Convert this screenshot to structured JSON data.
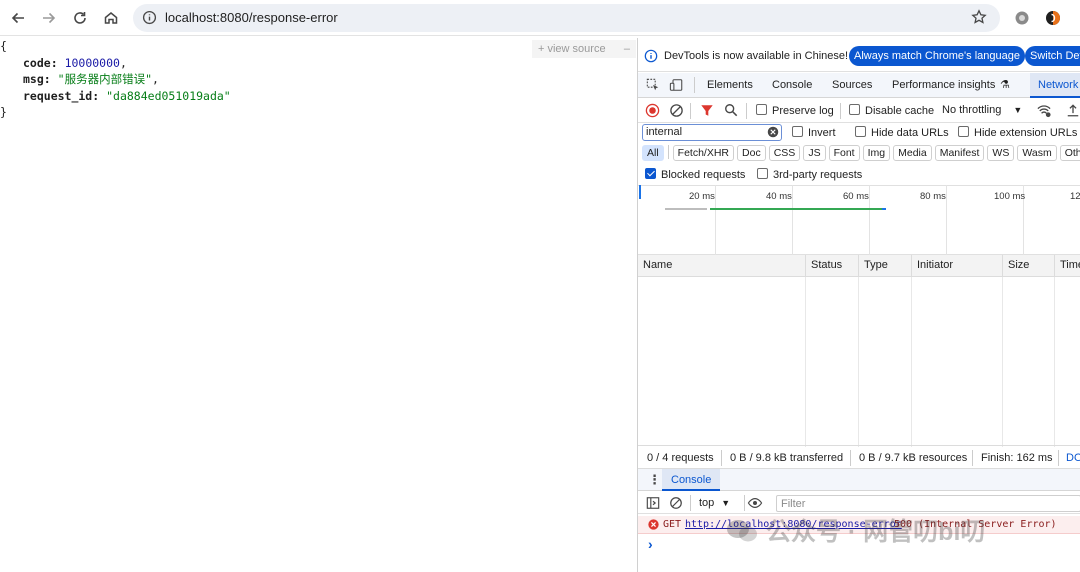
{
  "browser": {
    "url": "localhost:8080/response-error"
  },
  "page": {
    "open_brace": "{",
    "close_brace": "}",
    "lines": [
      {
        "key": "code",
        "value": "10000000",
        "type": "number"
      },
      {
        "key": "msg",
        "value": "\"服务器内部错误\"",
        "type": "string"
      },
      {
        "key": "request_id",
        "value": "\"da884ed051019ada\"",
        "type": "string"
      }
    ],
    "view_source": "+ view source"
  },
  "devtools": {
    "banner": {
      "text": "DevTools is now available in Chinese!",
      "primary_btn": "Always match Chrome's language",
      "secondary_btn": "Switch Dev"
    },
    "tabs": [
      "Elements",
      "Console",
      "Sources",
      "Performance insights",
      "Network"
    ],
    "active_tab": "Network",
    "toolbar": {
      "preserve_log": "Preserve log",
      "disable_cache": "Disable cache",
      "throttling": "No throttling"
    },
    "filter": {
      "value": "internal",
      "invert": "Invert",
      "hide_data_urls": "Hide data URLs",
      "hide_extension_urls": "Hide extension URLs"
    },
    "types": [
      "All",
      "Fetch/XHR",
      "Doc",
      "CSS",
      "JS",
      "Font",
      "Img",
      "Media",
      "Manifest",
      "WS",
      "Wasm",
      "Other"
    ],
    "blocked_requests": "Blocked requests",
    "third_party": "3rd-party requests",
    "timeline_ticks": [
      "20 ms",
      "40 ms",
      "60 ms",
      "80 ms",
      "100 ms",
      "12"
    ],
    "columns": [
      "Name",
      "Status",
      "Type",
      "Initiator",
      "Size",
      "Time"
    ],
    "status_bar": {
      "requests": "0 / 4 requests",
      "transferred": "0 B / 9.8 kB transferred",
      "resources": "0 B / 9.7 kB resources",
      "finish": "Finish: 162 ms",
      "dom": "DO"
    },
    "drawer": {
      "tab": "Console",
      "context": "top",
      "filter_placeholder": "Filter",
      "error": {
        "method": "GET",
        "url": "http://localhost:8080/response-error",
        "status": "500 (Internal Server Error)"
      },
      "prompt": "›"
    }
  },
  "watermark": "公众号 · 网管叨bi叨",
  "colors": {
    "accent": "#0b57d0",
    "error": "#dc362e",
    "error_bg": "#fceeee"
  }
}
